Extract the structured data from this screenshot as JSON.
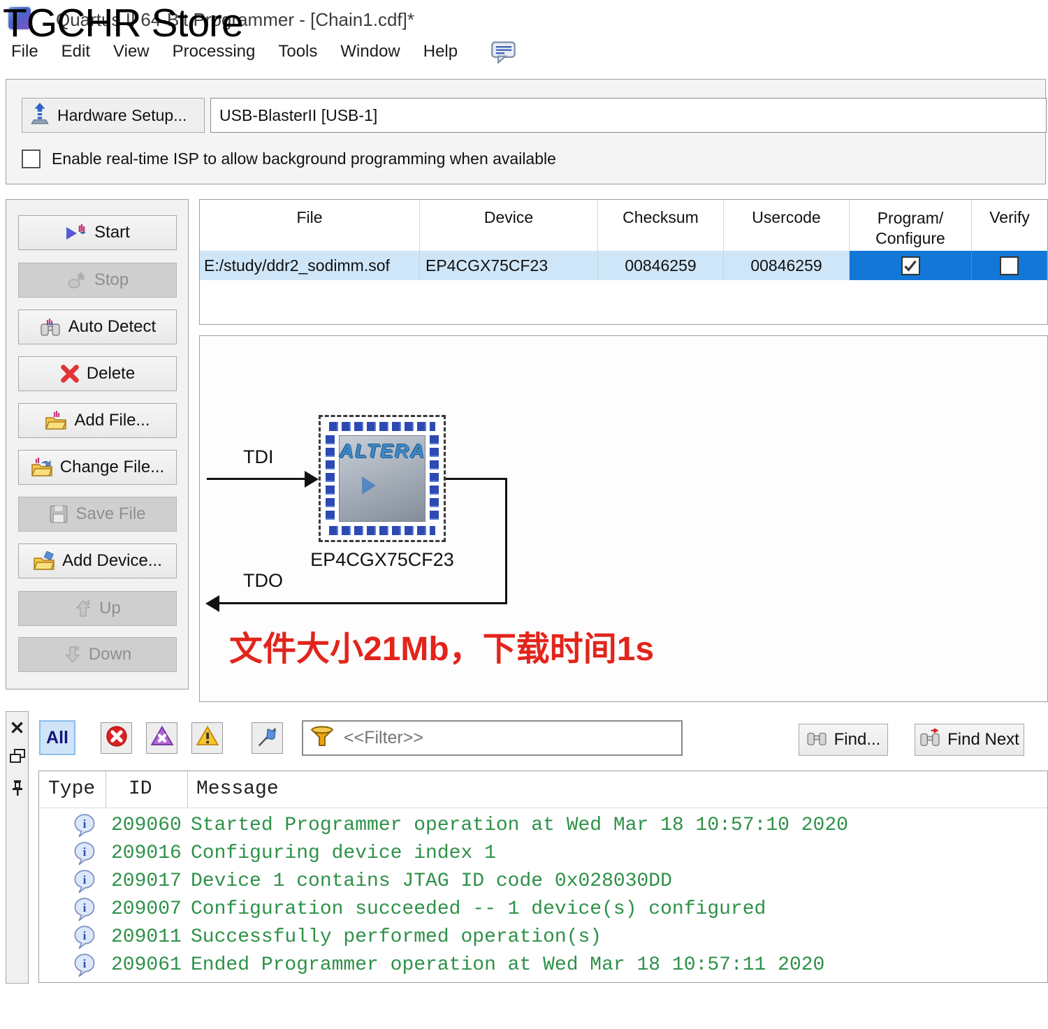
{
  "watermark": "TGCHR Store",
  "window": {
    "title": "Quartus II 64-Bit Programmer - [Chain1.cdf]*"
  },
  "menu": {
    "items": [
      "File",
      "Edit",
      "View",
      "Processing",
      "Tools",
      "Window",
      "Help"
    ]
  },
  "hardware": {
    "setup_button": "Hardware Setup...",
    "device_name": "USB-BlasterII [USB-1]",
    "isp_label": "Enable real-time ISP to allow background programming when available",
    "isp_checked": false
  },
  "actions": [
    {
      "label": "Start",
      "enabled": true
    },
    {
      "label": "Stop",
      "enabled": false
    },
    {
      "label": "Auto Detect",
      "enabled": true
    },
    {
      "label": "Delete",
      "enabled": true
    },
    {
      "label": "Add File...",
      "enabled": true
    },
    {
      "label": "Change File...",
      "enabled": true
    },
    {
      "label": "Save File",
      "enabled": false
    },
    {
      "label": "Add Device...",
      "enabled": true
    },
    {
      "label": "Up",
      "enabled": false
    },
    {
      "label": "Down",
      "enabled": false
    }
  ],
  "file_table": {
    "columns": [
      "File",
      "Device",
      "Checksum",
      "Usercode",
      "Program/\nConfigure",
      "Verify"
    ],
    "row": {
      "file": "E:/study/ddr2_sodimm.sof",
      "device": "EP4CGX75CF23",
      "checksum": "00846259",
      "usercode": "00846259",
      "program_configure": true,
      "verify": false
    }
  },
  "chain": {
    "tdi_label": "TDI",
    "tdo_label": "TDO",
    "chip_logo": "ALTERA",
    "device_label": "EP4CGX75CF23"
  },
  "annotation": {
    "text": "文件大小21Mb，下载时间1s",
    "color": "#e3241c"
  },
  "messages_panel": {
    "all_button": "All",
    "filter_placeholder": "<<Filter>>",
    "find_button": "Find...",
    "find_next_button": "Find Next",
    "table": {
      "columns": [
        "Type",
        "ID",
        "Message"
      ],
      "rows": [
        {
          "type": "info",
          "id": "209060",
          "message": "Started Programmer operation at Wed Mar 18 10:57:10 2020"
        },
        {
          "type": "info",
          "id": "209016",
          "message": "Configuring device index 1"
        },
        {
          "type": "info",
          "id": "209017",
          "message": "Device 1 contains JTAG ID code 0x028030DD"
        },
        {
          "type": "info",
          "id": "209007",
          "message": "Configuration succeeded -- 1 device(s) configured"
        },
        {
          "type": "info",
          "id": "209011",
          "message": "Successfully performed operation(s)"
        },
        {
          "type": "info",
          "id": "209061",
          "message": "Ended Programmer operation at Wed Mar 18 10:57:11 2020"
        }
      ]
    }
  },
  "colors": {
    "selection_blue": "#1277d7",
    "row_highlight": "#cfe6f8",
    "message_green": "#2e9148",
    "annotation_red": "#e3241c"
  }
}
